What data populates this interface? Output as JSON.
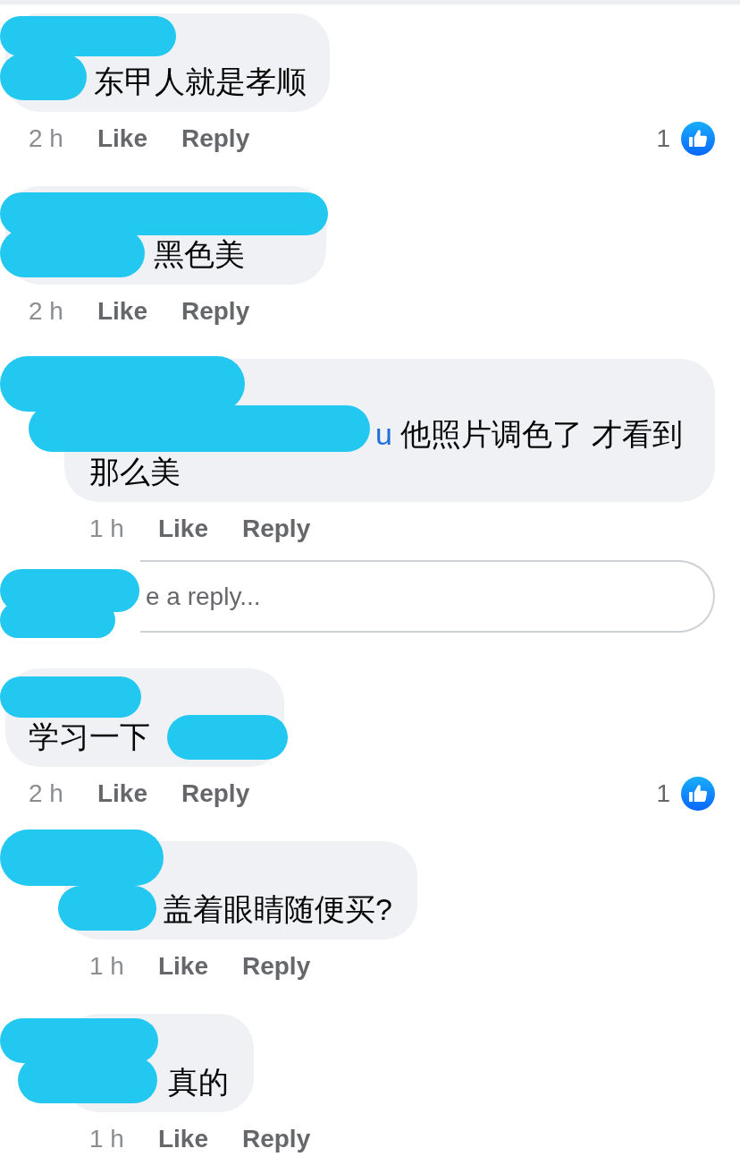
{
  "comments": [
    {
      "redacted": true,
      "text": "东甲人就是孝顺",
      "time": "2 h",
      "actions": [
        "Like",
        "Reply"
      ],
      "reaction_count": "1"
    },
    {
      "redacted": true,
      "text": "黑色美",
      "time": "2 h",
      "actions": [
        "Like",
        "Reply"
      ],
      "replies": [
        {
          "redacted": true,
          "mention": "u",
          "text": "他照片调色了 才看到那么美",
          "time": "1 h",
          "actions": [
            "Like",
            "Reply"
          ]
        }
      ],
      "reply_box": {
        "redacted": true,
        "placeholder": "e a reply..."
      }
    },
    {
      "redacted": true,
      "text": "学习一下",
      "time": "2 h",
      "actions": [
        "Like",
        "Reply"
      ],
      "reaction_count": "1",
      "replies": [
        {
          "redacted": true,
          "text": "盖着眼睛随便买?",
          "time": "1 h",
          "actions": [
            "Like",
            "Reply"
          ]
        },
        {
          "redacted": true,
          "text": "真的",
          "time": "1 h",
          "actions": [
            "Like",
            "Reply"
          ]
        }
      ]
    }
  ]
}
